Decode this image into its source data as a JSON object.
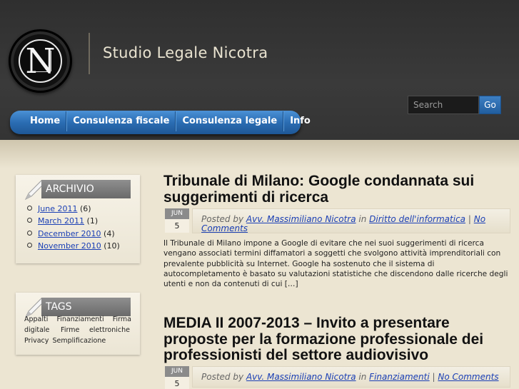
{
  "site": {
    "title": "Studio Legale Nicotra",
    "logo_letter": "N"
  },
  "search": {
    "placeholder": "Search",
    "button_label": "Go"
  },
  "nav": {
    "items": [
      {
        "label": "Home"
      },
      {
        "label": "Consulenza fiscale"
      },
      {
        "label": "Consulenza legale"
      },
      {
        "label": "Info"
      }
    ]
  },
  "sidebar": {
    "archive": {
      "title": "ARCHIVIO",
      "items": [
        {
          "label": "June 2011",
          "count": "(6)"
        },
        {
          "label": "March 2011",
          "count": "(1)"
        },
        {
          "label": "December 2010",
          "count": "(4)"
        },
        {
          "label": "November 2010",
          "count": "(10)"
        }
      ]
    },
    "tags": {
      "title": "TAGS",
      "items": [
        "Appalti",
        "Finanziamenti",
        "Firma digitale",
        "Firme elettroniche",
        "Privacy",
        "Semplificazione"
      ]
    }
  },
  "posts": [
    {
      "title": "Tribunale di Milano: Google condannata sui suggerimenti di ricerca",
      "date_month": "JUN",
      "date_day": "5",
      "posted_by": "Posted by",
      "author": "Avv. Massimiliano Nicotra",
      "in_label": "in",
      "category": "Diritto dell'informatica",
      "separator": "|",
      "comments": "No Comments",
      "excerpt": "Il Tribunale di Milano impone a Google di evitare che nei suoi suggerimenti di ricerca vengano associati termini diffamatori a soggetti che svolgono attività imprenditoriali con prevalente pubblicità su Internet. Google ha sostenuto che il sistema di autocompletamento è basato su valutazioni statistiche che discendono dalle ricerche degli utenti e non da contenuti di cui […]"
    },
    {
      "title": "MEDIA II 2007-2013 – Invito a presentare proposte per la formazione professionale dei professionisti del settore audiovisivo",
      "date_month": "JUN",
      "date_day": "5",
      "posted_by": "Posted by",
      "author": "Avv. Massimiliano Nicotra",
      "in_label": "in",
      "category": "Finanziamenti",
      "separator": "|",
      "comments": "No Comments"
    }
  ]
}
